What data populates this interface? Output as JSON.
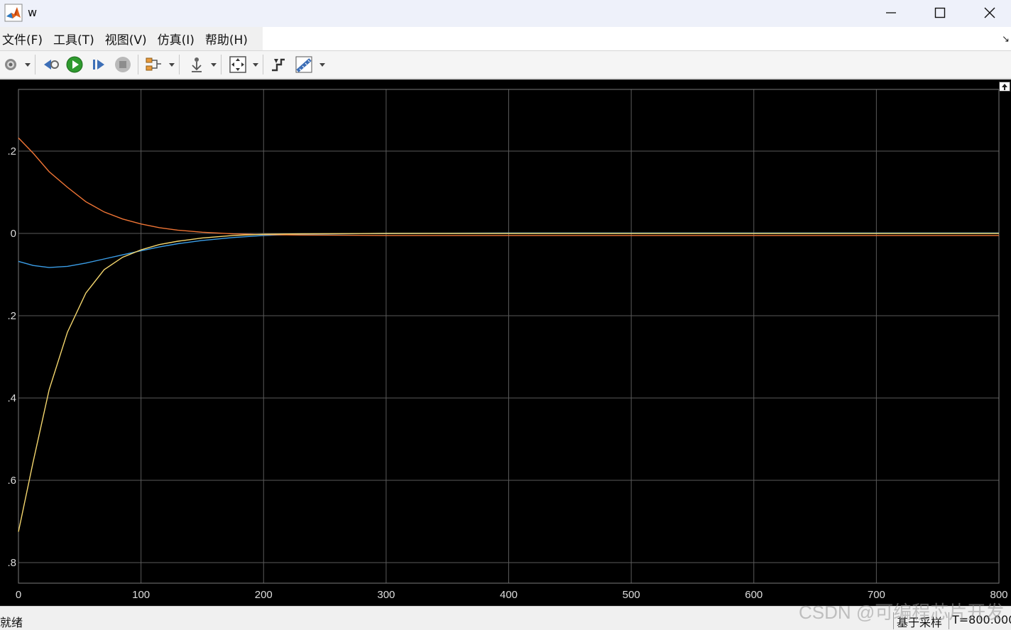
{
  "window": {
    "title": "w"
  },
  "menu": {
    "items": [
      "文件(F)",
      "工具(T)",
      "视图(V)",
      "仿真(I)",
      "帮助(H)"
    ]
  },
  "toolbar": {
    "icons": [
      "settings-icon",
      "step-back-icon",
      "run-icon",
      "step-forward-icon",
      "stop-icon",
      "signal-select-icon",
      "trigger-icon",
      "zoom-fit-icon",
      "restore-icon",
      "measure-icon"
    ]
  },
  "status": {
    "left": "就绪",
    "mode": "基于采样",
    "time": "T=800.000"
  },
  "watermark": "CSDN @可编程芯片开发",
  "colors": {
    "background": "#000000",
    "grid": "#5a5a5a",
    "axis_text": "#dddddd",
    "series_blue": "#3b9ee8",
    "series_orange": "#f07535",
    "series_yellow": "#f5d76e"
  },
  "chart_data": {
    "type": "line",
    "xlim": [
      0,
      800
    ],
    "ylim": [
      -0.85,
      0.35
    ],
    "grid": true,
    "x_ticks": [
      0,
      100,
      200,
      300,
      400,
      500,
      600,
      700,
      800
    ],
    "x_tick_labels": [
      "0",
      "100",
      "200",
      "300",
      "400",
      "500",
      "600",
      "700",
      "800"
    ],
    "y_ticks": [
      0.2,
      0,
      -0.2,
      -0.4,
      -0.6,
      -0.8
    ],
    "y_tick_labels": [
      ".2",
      "0",
      ".2",
      ".4",
      ".6",
      ".8"
    ],
    "series": [
      {
        "color": "#3b9ee8",
        "x": [
          0,
          12,
          25,
          40,
          55,
          70,
          85,
          100,
          115,
          130,
          150,
          175,
          200,
          230,
          300,
          400,
          500,
          600,
          700,
          800
        ],
        "y": [
          -0.068,
          -0.078,
          -0.083,
          -0.08,
          -0.072,
          -0.062,
          -0.052,
          -0.042,
          -0.033,
          -0.025,
          -0.017,
          -0.01,
          -0.005,
          -0.002,
          0.0,
          0.001,
          0.001,
          0.001,
          0.001,
          0.001
        ]
      },
      {
        "color": "#f07535",
        "x": [
          0,
          12,
          25,
          40,
          55,
          70,
          85,
          100,
          115,
          130,
          150,
          175,
          200,
          230,
          300,
          400,
          500,
          600,
          700,
          800
        ],
        "y": [
          0.232,
          0.195,
          0.15,
          0.112,
          0.077,
          0.052,
          0.035,
          0.023,
          0.014,
          0.008,
          0.003,
          -0.001,
          -0.003,
          -0.004,
          -0.005,
          -0.005,
          -0.005,
          -0.005,
          -0.005,
          -0.005
        ]
      },
      {
        "color": "#f5d76e",
        "x": [
          0,
          12,
          25,
          40,
          55,
          70,
          85,
          100,
          115,
          130,
          150,
          175,
          200,
          230,
          300,
          400,
          500,
          600,
          700,
          800
        ],
        "y": [
          -0.725,
          -0.555,
          -0.38,
          -0.24,
          -0.145,
          -0.088,
          -0.058,
          -0.04,
          -0.027,
          -0.019,
          -0.011,
          -0.005,
          -0.002,
          -0.001,
          0.0,
          0.0,
          0.0,
          0.0,
          0.0,
          0.0
        ]
      }
    ]
  }
}
